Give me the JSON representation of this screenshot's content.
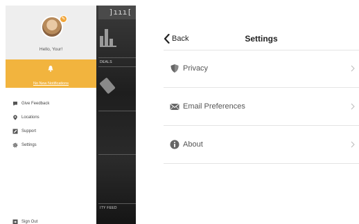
{
  "app_background": {
    "deals_label": "DEALS",
    "feed_label": "ITY FEED"
  },
  "drawer": {
    "greeting": "Hello, Your!",
    "notifications_link": "No New Notifications",
    "accent_color": "#f2b43e",
    "menu_items": [
      {
        "label": "Give Feedback",
        "icon": "chat-bubble-icon"
      },
      {
        "label": "Locations",
        "icon": "map-pin-icon"
      },
      {
        "label": "Support",
        "icon": "pencil-icon"
      },
      {
        "label": "Settings",
        "icon": "gear-icon"
      }
    ],
    "sign_out": "Sign Out"
  },
  "settings": {
    "back_label": "Back",
    "title": "Settings",
    "rows": [
      {
        "label": "Privacy",
        "icon": "shield-icon"
      },
      {
        "label": "Email Preferences",
        "icon": "envelope-icon"
      },
      {
        "label": "About",
        "icon": "info-icon"
      }
    ]
  }
}
